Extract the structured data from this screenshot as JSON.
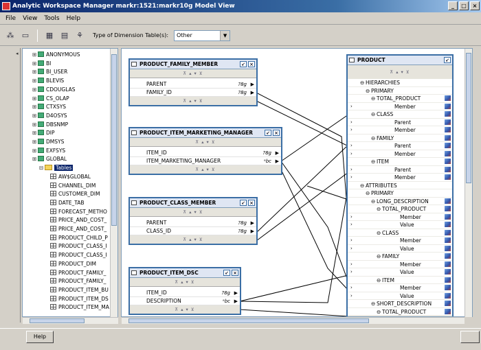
{
  "window": {
    "title": "Analytic Workspace Manager  markr:1521:markr10g    Model View"
  },
  "menu": [
    "File",
    "View",
    "Tools",
    "Help"
  ],
  "toolbar": {
    "dimension_label": "Type of Dimension Table(s):",
    "dimension_value": "Other"
  },
  "tree": {
    "schemas": [
      "ANONYMOUS",
      "BI",
      "BI_USER",
      "BLEVIS",
      "CDOUGLAS",
      "CS_OLAP",
      "CTXSYS",
      "D4OSYS",
      "DBSNMP",
      "DIP",
      "DMSYS",
      "EXFSYS",
      "GLOBAL"
    ],
    "folder": "Tables",
    "tables": [
      "AW$GLOBAL",
      "CHANNEL_DIM",
      "CUSTOMER_DIM",
      "DATE_TAB",
      "FORECAST_METHO",
      "PRICE_AND_COST_",
      "PRICE_AND_COST_",
      "PRODUCT_CHILD_P",
      "PRODUCT_CLASS_I",
      "PRODUCT_CLASS_I",
      "PRODUCT_DIM",
      "PRODUCT_FAMILY_",
      "PRODUCT_FAMILY_",
      "PRODUCT_ITEM_BU",
      "PRODUCT_ITEM_DS",
      "PRODUCT_ITEM_MA"
    ]
  },
  "tables": [
    {
      "name": "PRODUCT_FAMILY_MEMBER",
      "columns": [
        {
          "name": "PARENT",
          "type": "?8g"
        },
        {
          "name": "FAMILY_ID",
          "type": "?8g"
        }
      ]
    },
    {
      "name": "PRODUCT_ITEM_MARKETING_MANAGER",
      "columns": [
        {
          "name": "ITEM_ID",
          "type": "?8g"
        },
        {
          "name": "ITEM_MARKETING_MANAGER",
          "type": "ᵃbc"
        }
      ]
    },
    {
      "name": "PRODUCT_CLASS_MEMBER",
      "columns": [
        {
          "name": "PARENT",
          "type": "?8g"
        },
        {
          "name": "CLASS_ID",
          "type": "?8g"
        }
      ]
    },
    {
      "name": "PRODUCT_ITEM_DSC",
      "columns": [
        {
          "name": "ITEM_ID",
          "type": "?8g"
        },
        {
          "name": "DESCRIPTION",
          "type": "ᵃbc"
        }
      ]
    }
  ],
  "product": {
    "name": "PRODUCT",
    "rows": [
      {
        "label": "HIERARCHIES",
        "level": 0,
        "exp": "⊖",
        "arrow": false,
        "cube": false
      },
      {
        "label": "PRIMARY",
        "level": 1,
        "exp": "⊖",
        "arrow": false,
        "cube": false
      },
      {
        "label": "TOTAL_PRODUCT",
        "level": 2,
        "exp": "⊖",
        "arrow": false,
        "cube": true
      },
      {
        "label": "Member",
        "level": 3,
        "exp": "",
        "arrow": true,
        "cube": true
      },
      {
        "label": "CLASS",
        "level": 2,
        "exp": "⊖",
        "arrow": false,
        "cube": true
      },
      {
        "label": "Parent",
        "level": 3,
        "exp": "",
        "arrow": true,
        "cube": true
      },
      {
        "label": "Member",
        "level": 3,
        "exp": "",
        "arrow": true,
        "cube": true
      },
      {
        "label": "FAMILY",
        "level": 2,
        "exp": "⊖",
        "arrow": false,
        "cube": true
      },
      {
        "label": "Parent",
        "level": 3,
        "exp": "",
        "arrow": true,
        "cube": true
      },
      {
        "label": "Member",
        "level": 3,
        "exp": "",
        "arrow": true,
        "cube": true
      },
      {
        "label": "ITEM",
        "level": 2,
        "exp": "⊖",
        "arrow": false,
        "cube": true
      },
      {
        "label": "Parent",
        "level": 3,
        "exp": "",
        "arrow": true,
        "cube": true
      },
      {
        "label": "Member",
        "level": 3,
        "exp": "",
        "arrow": true,
        "cube": true
      },
      {
        "label": "ATTRIBUTES",
        "level": 0,
        "exp": "⊖",
        "arrow": false,
        "cube": false
      },
      {
        "label": "PRIMARY",
        "level": 1,
        "exp": "⊖",
        "arrow": false,
        "cube": false
      },
      {
        "label": "LONG_DESCRIPTION",
        "level": 2,
        "exp": "⊖",
        "arrow": false,
        "cube": true
      },
      {
        "label": "TOTAL_PRODUCT",
        "level": 3,
        "exp": "⊖",
        "arrow": false,
        "cube": true
      },
      {
        "label": "Member",
        "level": 4,
        "exp": "",
        "arrow": true,
        "cube": true
      },
      {
        "label": "Value",
        "level": 4,
        "exp": "",
        "arrow": true,
        "cube": true
      },
      {
        "label": "CLASS",
        "level": 3,
        "exp": "⊖",
        "arrow": false,
        "cube": true
      },
      {
        "label": "Member",
        "level": 4,
        "exp": "",
        "arrow": true,
        "cube": true
      },
      {
        "label": "Value",
        "level": 4,
        "exp": "",
        "arrow": true,
        "cube": true
      },
      {
        "label": "FAMILY",
        "level": 3,
        "exp": "⊖",
        "arrow": false,
        "cube": true
      },
      {
        "label": "Member",
        "level": 4,
        "exp": "",
        "arrow": true,
        "cube": true
      },
      {
        "label": "Value",
        "level": 4,
        "exp": "",
        "arrow": true,
        "cube": true
      },
      {
        "label": "ITEM",
        "level": 3,
        "exp": "⊖",
        "arrow": false,
        "cube": true
      },
      {
        "label": "Member",
        "level": 4,
        "exp": "",
        "arrow": true,
        "cube": true
      },
      {
        "label": "Value",
        "level": 4,
        "exp": "",
        "arrow": true,
        "cube": true
      },
      {
        "label": "SHORT_DESCRIPTION",
        "level": 2,
        "exp": "⊖",
        "arrow": false,
        "cube": true
      },
      {
        "label": "TOTAL_PRODUCT",
        "level": 3,
        "exp": "⊖",
        "arrow": false,
        "cube": true
      }
    ]
  },
  "buttons": {
    "help": "Help"
  }
}
